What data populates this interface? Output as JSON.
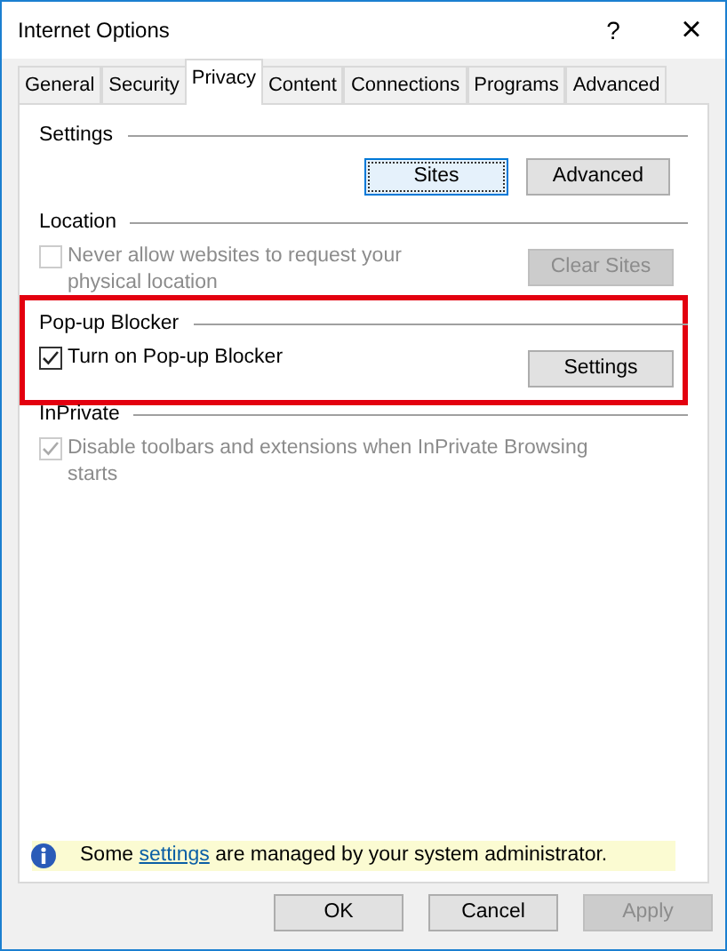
{
  "window": {
    "title": "Internet Options",
    "help": "?",
    "close": "×"
  },
  "tabs": [
    {
      "label": "General",
      "selected": false
    },
    {
      "label": "Security",
      "selected": false
    },
    {
      "label": "Privacy",
      "selected": true
    },
    {
      "label": "Content",
      "selected": false
    },
    {
      "label": "Connections",
      "selected": false
    },
    {
      "label": "Programs",
      "selected": false
    },
    {
      "label": "Advanced",
      "selected": false
    }
  ],
  "sections": [
    {
      "title": "Settings",
      "kind": "buttons",
      "buttons": [
        {
          "label": "Sites",
          "focused": true,
          "disabled": false
        },
        {
          "label": "Advanced",
          "focused": false,
          "disabled": false
        }
      ]
    },
    {
      "title": "Location",
      "kind": "checkbox",
      "checkbox": {
        "label": "Never allow websites to request your physical location",
        "checked": false,
        "disabled": true
      },
      "button": {
        "label": "Clear Sites",
        "disabled": true
      }
    },
    {
      "title": "Pop-up Blocker",
      "kind": "checkbox",
      "highlighted": true,
      "checkbox": {
        "label": "Turn on Pop-up Blocker",
        "checked": true,
        "disabled": false
      },
      "button": {
        "label": "Settings",
        "disabled": false
      }
    },
    {
      "title": "InPrivate",
      "kind": "checkbox",
      "checkbox": {
        "label": "Disable toolbars and extensions when InPrivate Browsing starts",
        "checked": true,
        "disabled": true
      }
    }
  ],
  "info": {
    "before": "Some",
    "link": "settings",
    "after": "are managed by your system administrator."
  },
  "buttons": [
    {
      "label": "OK",
      "disabled": false
    },
    {
      "label": "Cancel",
      "disabled": false
    },
    {
      "label": "Apply",
      "disabled": true
    }
  ]
}
